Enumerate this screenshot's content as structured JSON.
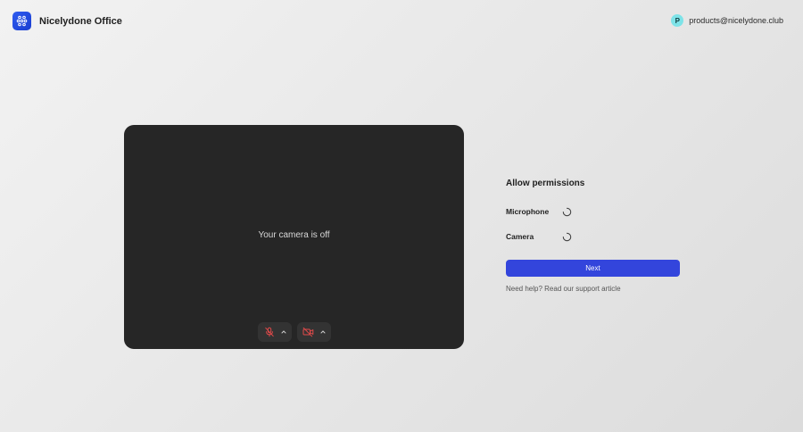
{
  "header": {
    "app_name": "Nicelydone Office",
    "account": {
      "avatar_initial": "P",
      "email": "products@nicelydone.club"
    }
  },
  "preview": {
    "camera_off_text": "Your camera is off",
    "controls": {
      "microphone_icon": "mic-off-icon",
      "camera_icon": "camera-off-icon",
      "caret_icon": "chevron-up-icon"
    }
  },
  "permissions": {
    "title": "Allow permissions",
    "items": [
      {
        "label": "Microphone",
        "status_icon": "loading-spinner-icon"
      },
      {
        "label": "Camera",
        "status_icon": "loading-spinner-icon"
      }
    ],
    "next_label": "Next",
    "help_text": "Need help? Read our support article"
  },
  "colors": {
    "accent": "#3345dc",
    "logo": "#2f5cf0",
    "avatar": "#7ee3e8",
    "preview_bg": "#262626",
    "muted_red": "#e04a4a"
  }
}
